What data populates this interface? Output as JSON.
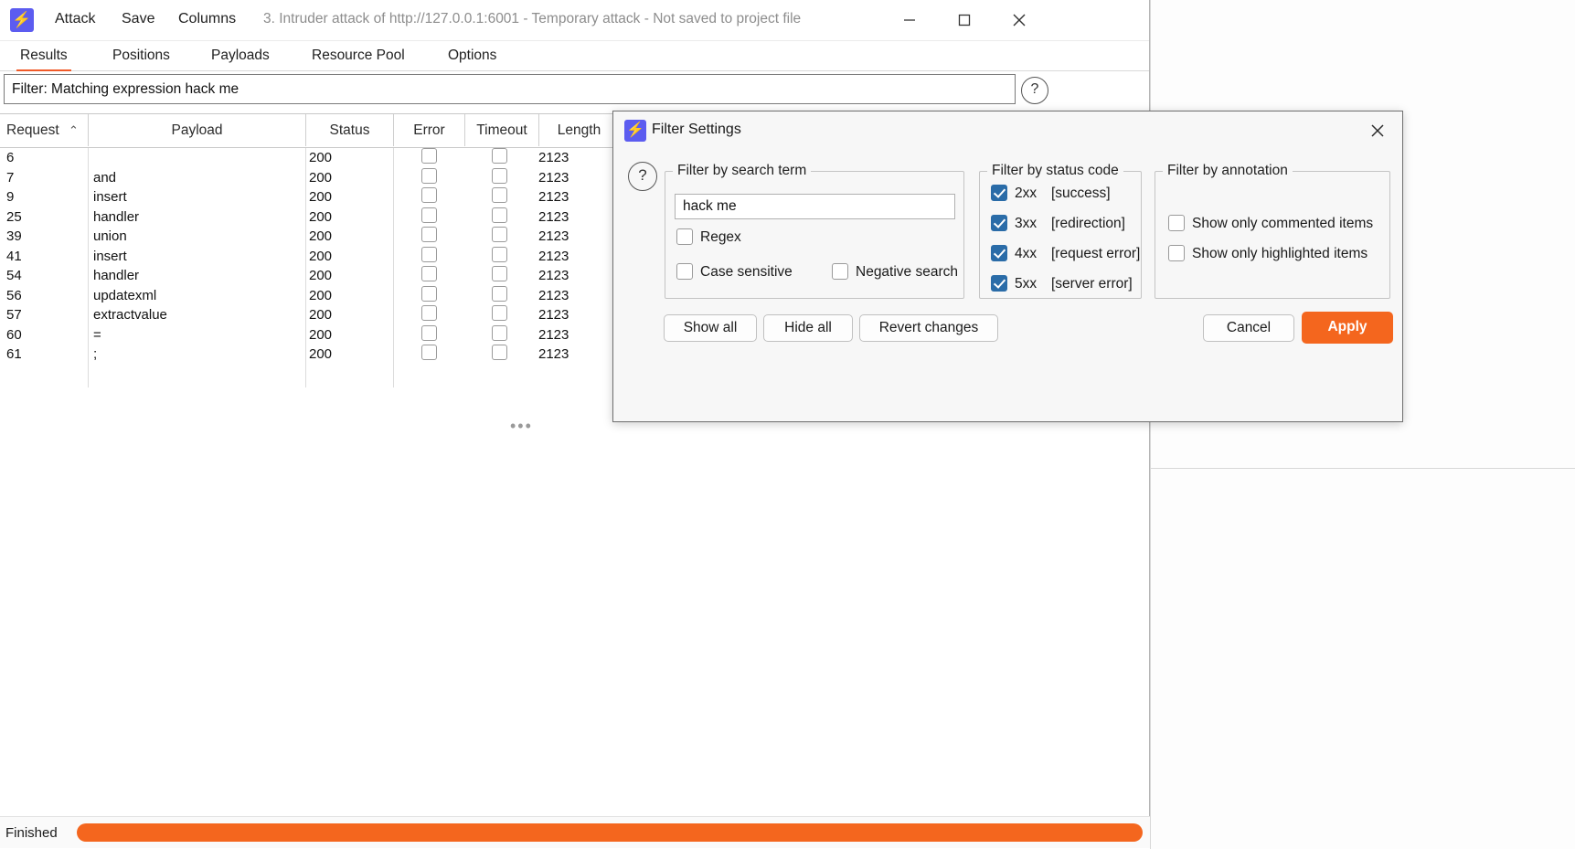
{
  "window": {
    "menu": [
      "Attack",
      "Save",
      "Columns"
    ],
    "title": "3. Intruder attack of http://127.0.0.1:6001 - Temporary attack - Not saved to project file",
    "controls": {
      "minimize": "minimize-icon",
      "maximize": "maximize-icon",
      "close": "close-icon"
    },
    "logo_glyph": "⚡"
  },
  "tabs": [
    {
      "label": "Results",
      "active": true
    },
    {
      "label": "Positions",
      "active": false
    },
    {
      "label": "Payloads",
      "active": false
    },
    {
      "label": "Resource Pool",
      "active": false
    },
    {
      "label": "Options",
      "active": false
    }
  ],
  "filter_bar": {
    "value": "Filter: Matching expression hack me",
    "help_glyph": "?"
  },
  "results_table": {
    "columns": [
      "Request",
      "Payload",
      "Status",
      "Error",
      "Timeout",
      "Length"
    ],
    "sort_column": "Request",
    "sort_indicator": "⌃",
    "rows": [
      {
        "request": "6",
        "payload": "",
        "status": "200",
        "error": false,
        "timeout": false,
        "length": "2123"
      },
      {
        "request": "7",
        "payload": "and",
        "status": "200",
        "error": false,
        "timeout": false,
        "length": "2123"
      },
      {
        "request": "9",
        "payload": "insert",
        "status": "200",
        "error": false,
        "timeout": false,
        "length": "2123"
      },
      {
        "request": "25",
        "payload": "handler",
        "status": "200",
        "error": false,
        "timeout": false,
        "length": "2123"
      },
      {
        "request": "39",
        "payload": "union",
        "status": "200",
        "error": false,
        "timeout": false,
        "length": "2123"
      },
      {
        "request": "41",
        "payload": "insert",
        "status": "200",
        "error": false,
        "timeout": false,
        "length": "2123"
      },
      {
        "request": "54",
        "payload": "handler",
        "status": "200",
        "error": false,
        "timeout": false,
        "length": "2123"
      },
      {
        "request": "56",
        "payload": "updatexml",
        "status": "200",
        "error": false,
        "timeout": false,
        "length": "2123"
      },
      {
        "request": "57",
        "payload": "extractvalue",
        "status": "200",
        "error": false,
        "timeout": false,
        "length": "2123"
      },
      {
        "request": "60",
        "payload": "=",
        "status": "200",
        "error": false,
        "timeout": false,
        "length": "2123"
      },
      {
        "request": "61",
        "payload": ";",
        "status": "200",
        "error": false,
        "timeout": false,
        "length": "2123"
      }
    ]
  },
  "status_bar": {
    "text": "Finished",
    "progress_color": "#f4661e"
  },
  "dialog": {
    "title": "Filter Settings",
    "logo_glyph": "⚡",
    "help_glyph": "?",
    "close_icon": "close-icon",
    "search_group": {
      "title": "Filter by search term",
      "input_value": "hack me",
      "input_placeholder": "",
      "regex": {
        "label": "Regex",
        "checked": false
      },
      "case_sensitive": {
        "label": "Case sensitive",
        "checked": false
      },
      "negative_search": {
        "label": "Negative search",
        "checked": false
      }
    },
    "status_group": {
      "title": "Filter by status code",
      "items": [
        {
          "code": "2xx",
          "desc": "[success]",
          "checked": true
        },
        {
          "code": "3xx",
          "desc": "[redirection]",
          "checked": true
        },
        {
          "code": "4xx",
          "desc": "[request error]",
          "checked": true
        },
        {
          "code": "5xx",
          "desc": "[server error]",
          "checked": true
        }
      ]
    },
    "annotation_group": {
      "title": "Filter by annotation",
      "items": [
        {
          "label": "Show only commented items",
          "checked": false
        },
        {
          "label": "Show only highlighted items",
          "checked": false
        }
      ]
    },
    "buttons": {
      "show_all": "Show all",
      "hide_all": "Hide all",
      "revert": "Revert changes",
      "cancel": "Cancel",
      "apply": "Apply"
    },
    "accent_color": "#f4661e"
  }
}
